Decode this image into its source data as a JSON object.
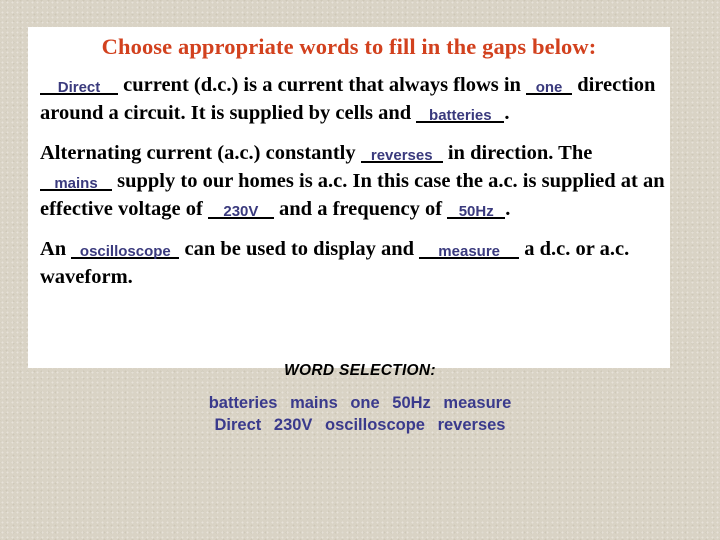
{
  "slide": {
    "title": "Choose appropriate words to fill in the gaps below:",
    "title_color": "#d2411e",
    "answer_color": "#3a3a7d",
    "wordlist_color": "#3a3a8c",
    "background_color": "#d9d3c5",
    "panel_color": "#ffffff"
  },
  "paragraphs": [
    {
      "segments": [
        {
          "type": "blank",
          "value": "Direct"
        },
        {
          "type": "text",
          "value": " current (d.c.) is a current that always flows in "
        },
        {
          "type": "blank",
          "value": "one"
        },
        {
          "type": "text",
          "value": " direction around a circuit. It is supplied by cells and "
        },
        {
          "type": "blank",
          "value": "batteries"
        },
        {
          "type": "text",
          "value": "."
        }
      ]
    },
    {
      "segments": [
        {
          "type": "text",
          "value": "Alternating current (a.c.) constantly "
        },
        {
          "type": "blank",
          "value": "reverses"
        },
        {
          "type": "text",
          "value": " in direction. The "
        },
        {
          "type": "blank",
          "value": "mains"
        },
        {
          "type": "text",
          "value": " supply to our homes is a.c.  In this case the a.c. is supplied at an effective voltage of "
        },
        {
          "type": "blank",
          "value": "230V"
        },
        {
          "type": "text",
          "value": " and a frequency of "
        },
        {
          "type": "blank",
          "value": "50Hz"
        },
        {
          "type": "text",
          "value": "."
        }
      ]
    },
    {
      "segments": [
        {
          "type": "text",
          "value": "An "
        },
        {
          "type": "blank",
          "value": "oscilloscope"
        },
        {
          "type": "text",
          "value": " can be used to display and "
        },
        {
          "type": "blank",
          "value": "measure"
        },
        {
          "type": "text",
          "value": " a d.c. or a.c. waveform."
        }
      ]
    }
  ],
  "word_selection": {
    "heading": "WORD SELECTION:",
    "rows": [
      [
        "batteries",
        "mains",
        "one",
        "50Hz",
        "measure"
      ],
      [
        "Direct",
        "230V",
        "oscilloscope",
        "reverses"
      ]
    ]
  },
  "answers": {
    "p1_blank1": "Direct",
    "p1_blank2": "one",
    "p1_blank3": "batteries",
    "p2_blank1": "reverses",
    "p2_blank2": "mains",
    "p2_blank3": "230V",
    "p2_blank4": "50Hz",
    "p3_blank1": "oscilloscope",
    "p3_blank2": "measure"
  },
  "text_runs": {
    "p1_t1": " current (d.c.) is a current that always flows in ",
    "p1_t2": " direction around a circuit. It is supplied by cells and ",
    "p1_t3": ".",
    "p2_t1": "Alternating current (a.c.) constantly ",
    "p2_t2": " in direction. The ",
    "p2_t3": " supply to our homes is a.c.  In this case the a.c. is supplied at an effective voltage of ",
    "p2_t4": " and a frequency of ",
    "p2_t5": ".",
    "p3_t1": "An ",
    "p3_t2": " can be used to display and ",
    "p3_t3": " a d.c. or a.c. waveform."
  }
}
